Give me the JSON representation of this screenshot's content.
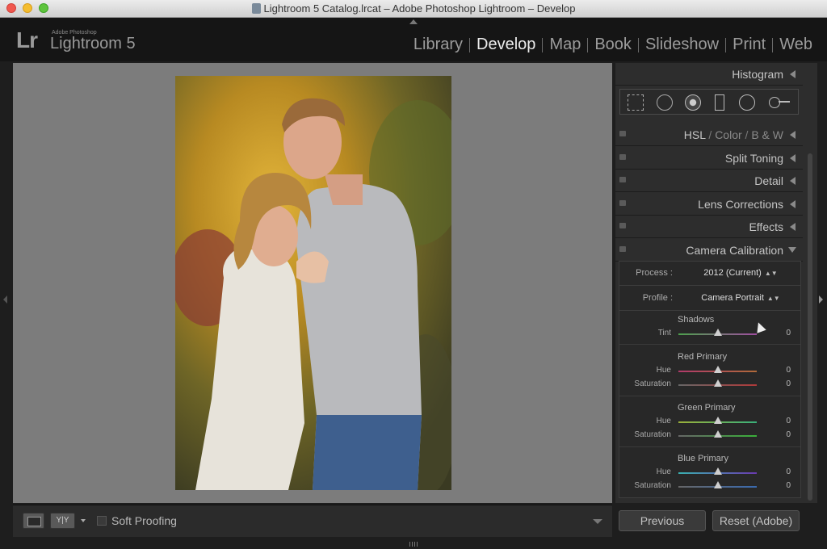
{
  "window": {
    "title": "Lightroom 5 Catalog.lrcat – Adobe Photoshop Lightroom – Develop"
  },
  "identity": {
    "logo": "Lr",
    "vendor": "Adobe Photoshop",
    "product": "Lightroom 5"
  },
  "modules": [
    {
      "label": "Library",
      "active": false
    },
    {
      "label": "Develop",
      "active": true
    },
    {
      "label": "Map",
      "active": false
    },
    {
      "label": "Book",
      "active": false
    },
    {
      "label": "Slideshow",
      "active": false
    },
    {
      "label": "Print",
      "active": false
    },
    {
      "label": "Web",
      "active": false
    }
  ],
  "toolbar": {
    "soft_proofing_label": "Soft Proofing",
    "soft_proofing_checked": false,
    "yy_label": "Y|Y"
  },
  "panels": {
    "histogram": "Histogram",
    "hsl": {
      "hsl": "HSL",
      "sep": "/",
      "color": "Color",
      "bw": "B & W"
    },
    "split_toning": "Split Toning",
    "detail": "Detail",
    "lens_corrections": "Lens Corrections",
    "effects": "Effects",
    "camera_calibration": "Camera Calibration"
  },
  "tools": [
    "crop-overlay-icon",
    "spot-removal-icon",
    "red-eye-icon",
    "graduated-filter-icon",
    "radial-filter-icon",
    "adjustment-brush-icon"
  ],
  "calibration": {
    "process_label": "Process :",
    "process_value": "2012 (Current)",
    "profile_label": "Profile :",
    "profile_value": "Camera Portrait",
    "shadows": {
      "title": "Shadows",
      "tint_label": "Tint",
      "tint_value": "0"
    },
    "red": {
      "title": "Red Primary",
      "hue_label": "Hue",
      "hue_value": "0",
      "sat_label": "Saturation",
      "sat_value": "0"
    },
    "green": {
      "title": "Green Primary",
      "hue_label": "Hue",
      "hue_value": "0",
      "sat_label": "Saturation",
      "sat_value": "0"
    },
    "blue": {
      "title": "Blue Primary",
      "hue_label": "Hue",
      "hue_value": "0",
      "sat_label": "Saturation",
      "sat_value": "0"
    }
  },
  "buttons": {
    "previous": "Previous",
    "reset": "Reset (Adobe)"
  },
  "colors": {
    "active_module": "#ececec",
    "inactive_module": "#9c9c9c",
    "canvas_bg": "#7c7c7c",
    "panel_bg": "#2d2d2d"
  }
}
